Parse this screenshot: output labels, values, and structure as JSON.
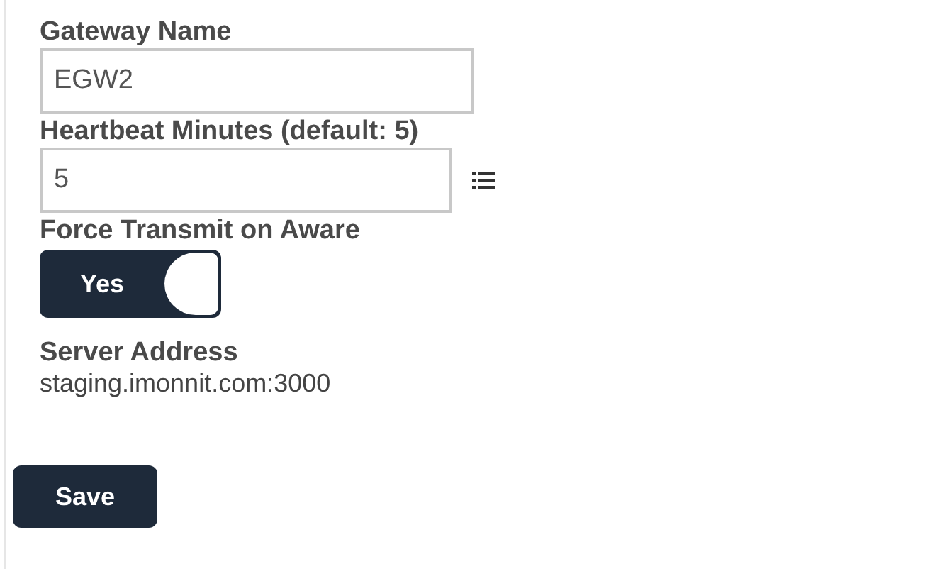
{
  "fields": [
    {
      "kind": "text",
      "label": "Gateway Name",
      "value": "EGW2"
    },
    {
      "kind": "text-list",
      "label": "Heartbeat Minutes (default: 5)",
      "value": "5"
    },
    {
      "kind": "toggle",
      "label": "Force Transmit on Aware",
      "on": true,
      "on_text": "Yes"
    },
    {
      "kind": "readonly",
      "label": "Server Address",
      "value": "staging.imonnit.com:3000"
    }
  ],
  "buttons": [
    "Save"
  ]
}
